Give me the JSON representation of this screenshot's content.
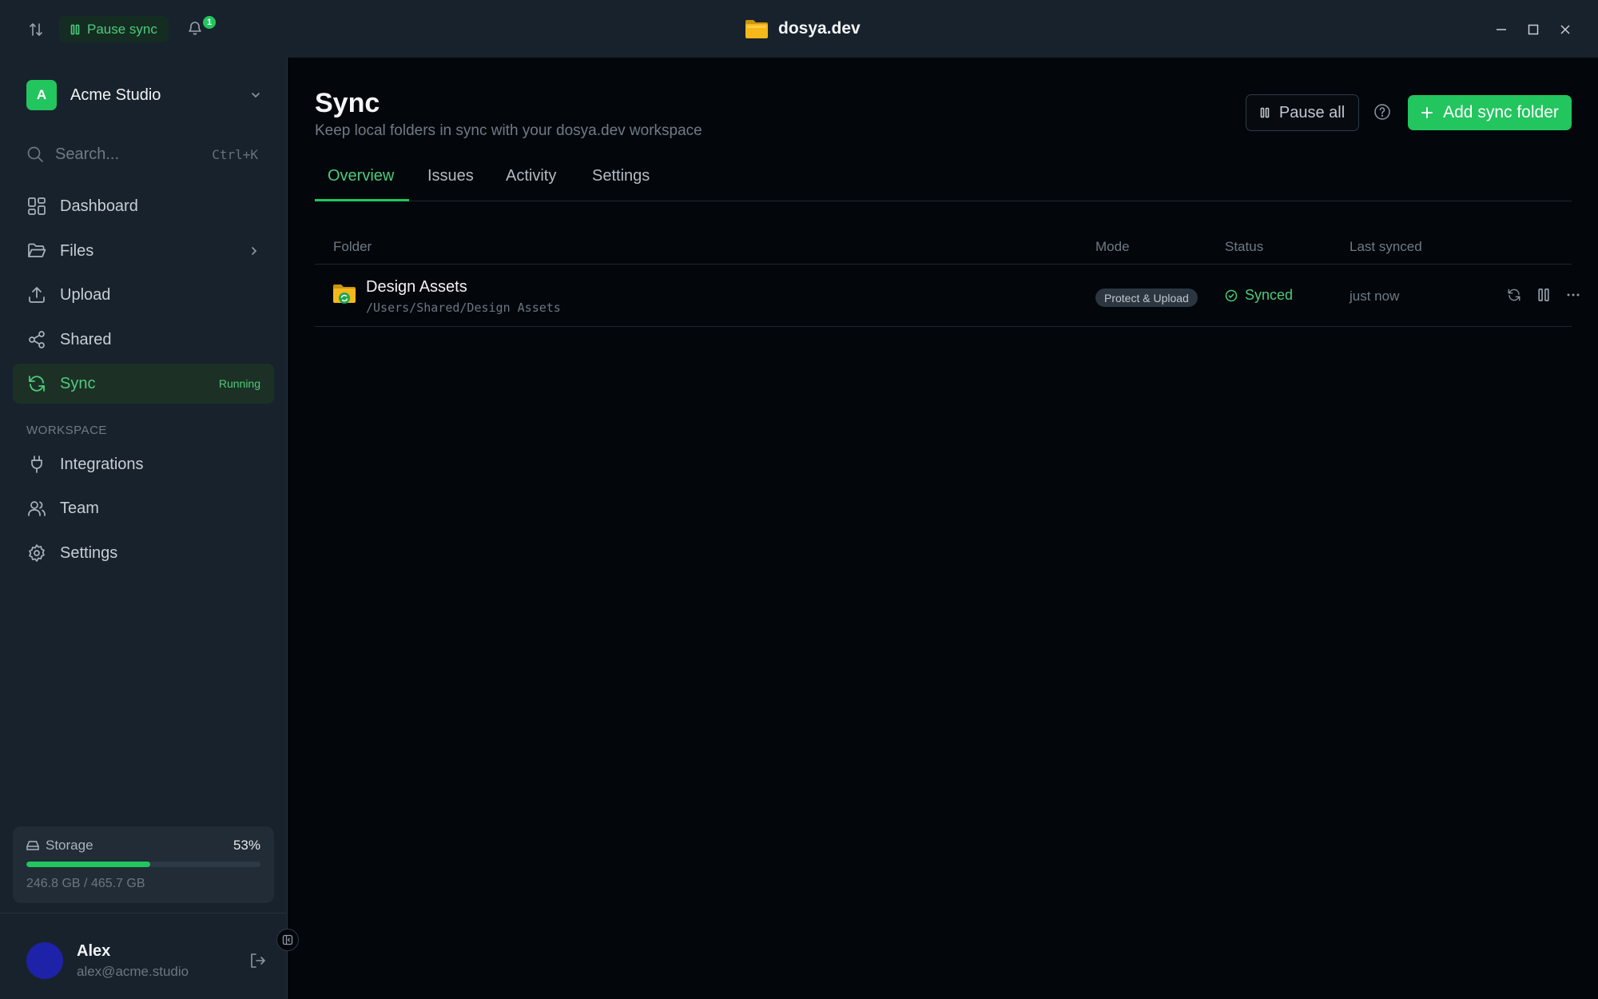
{
  "titlebar": {
    "pause_sync_label": "Pause sync",
    "notifications_count": "1",
    "app_title": "dosya.dev"
  },
  "sidebar": {
    "workspace": {
      "initial": "A",
      "name": "Acme Studio"
    },
    "search": {
      "placeholder": "Search...",
      "shortcut": "Ctrl+K"
    },
    "nav": [
      {
        "label": "Dashboard",
        "icon": "grid-icon"
      },
      {
        "label": "Files",
        "icon": "folder-open-icon"
      },
      {
        "label": "Upload",
        "icon": "upload-icon"
      },
      {
        "label": "Shared",
        "icon": "share-icon"
      },
      {
        "label": "Sync",
        "icon": "refresh-icon",
        "badge": "Running"
      }
    ],
    "section_label": "WORKSPACE",
    "workspace_nav": [
      {
        "label": "Integrations",
        "icon": "plug-icon"
      },
      {
        "label": "Team",
        "icon": "users-icon"
      },
      {
        "label": "Settings",
        "icon": "gear-icon"
      }
    ],
    "storage": {
      "label": "Storage",
      "percent_label": "53%",
      "percent": 53,
      "used": "246.8 GB / 465.7 GB"
    },
    "user": {
      "name": "Alex",
      "email": "alex@acme.studio"
    }
  },
  "main": {
    "title": "Sync",
    "subtitle": "Keep local folders in sync with your dosya.dev workspace",
    "pause_all_label": "Pause all",
    "add_label": "Add sync folder",
    "tabs": [
      "Overview",
      "Issues",
      "Activity",
      "Settings"
    ],
    "active_tab": "Overview",
    "table": {
      "headers": {
        "folder": "Folder",
        "mode": "Mode",
        "status": "Status",
        "last": "Last synced"
      },
      "rows": [
        {
          "name": "Design Assets",
          "path": "/Users/Shared/Design Assets",
          "mode": "Protect & Upload",
          "status": "Synced",
          "last": "just now"
        }
      ]
    }
  },
  "colors": {
    "accent": "#22c55e",
    "bg": "#03070b",
    "sidebar": "#18222c"
  }
}
